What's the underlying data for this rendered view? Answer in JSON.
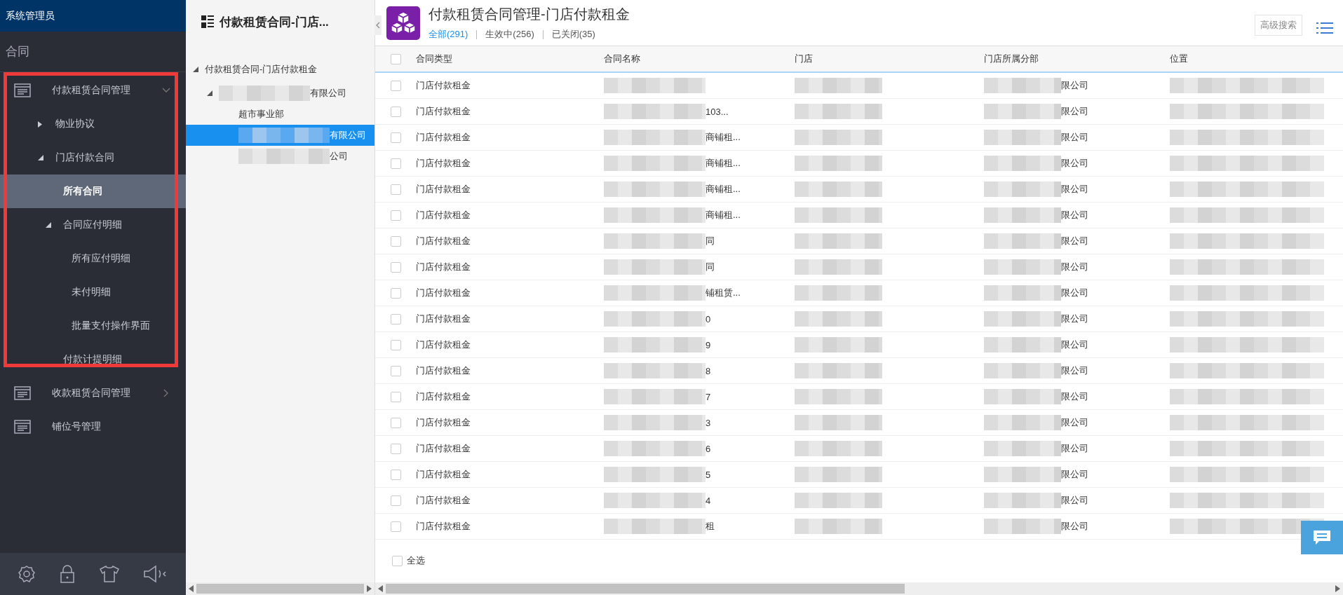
{
  "sidebar": {
    "user": "系统管理员",
    "section": "合同",
    "menu": [
      {
        "label": "付款租赁合同管理",
        "expanded": true,
        "selected": false,
        "children": [
          {
            "label": "物业协议",
            "expanded": false,
            "selected": false
          },
          {
            "label": "门店付款合同",
            "expanded": true,
            "selected": false,
            "children": [
              {
                "label": "所有合同",
                "selected": true
              },
              {
                "label": "合同应付明细",
                "expanded": true,
                "selected": false,
                "children": [
                  {
                    "label": "所有应付明细",
                    "selected": false
                  },
                  {
                    "label": "未付明细",
                    "selected": false
                  },
                  {
                    "label": "批量支付操作界面",
                    "selected": false
                  }
                ]
              },
              {
                "label": "付款计提明细",
                "selected": false
              }
            ]
          }
        ]
      },
      {
        "label": "收款租赁合同管理",
        "expanded": false,
        "selected": false
      },
      {
        "label": "铺位号管理",
        "selected": false
      }
    ]
  },
  "tree_panel": {
    "title": "付款租赁合同-门店...",
    "nodes": [
      {
        "label": "付款租赁合同-门店付款租金",
        "expanded": true,
        "selected": false,
        "children": [
          {
            "label": "有限公司",
            "redacted": true,
            "expanded": true,
            "selected": false,
            "children": [
              {
                "label": "超市事业部",
                "selected": false
              },
              {
                "label": "有限公司",
                "redacted": true,
                "selected": true
              },
              {
                "label": "公司",
                "redacted": true,
                "selected": false
              }
            ]
          }
        ]
      }
    ]
  },
  "header": {
    "title": "付款租赁合同管理-门店付款租金",
    "tabs": [
      {
        "label": "全部(291)",
        "selected": true
      },
      {
        "label": "生效中(256)",
        "selected": false
      },
      {
        "label": "已关闭(35)",
        "selected": false
      }
    ],
    "advanced_search": "高级搜索"
  },
  "table": {
    "header_checked": false,
    "columns": [
      "合同类型",
      "合同名称",
      "门店",
      "门店所属分部",
      "位置"
    ],
    "rows": [
      {
        "checked": false,
        "type": "门店付款租金",
        "name": "",
        "branch": "限公司"
      },
      {
        "checked": false,
        "type": "门店付款租金",
        "name": "103...",
        "branch": "限公司"
      },
      {
        "checked": false,
        "type": "门店付款租金",
        "name": "商铺租...",
        "branch": "限公司"
      },
      {
        "checked": false,
        "type": "门店付款租金",
        "name": "商铺租...",
        "branch": "限公司"
      },
      {
        "checked": false,
        "type": "门店付款租金",
        "name": "商铺租...",
        "branch": "限公司"
      },
      {
        "checked": false,
        "type": "门店付款租金",
        "name": "商铺租...",
        "branch": "限公司"
      },
      {
        "checked": false,
        "type": "门店付款租金",
        "name": "同",
        "branch": "限公司"
      },
      {
        "checked": false,
        "type": "门店付款租金",
        "name": "同",
        "branch": "限公司"
      },
      {
        "checked": false,
        "type": "门店付款租金",
        "name": "铺租赁...",
        "branch": "限公司"
      },
      {
        "checked": false,
        "type": "门店付款租金",
        "name": "0",
        "branch": "限公司"
      },
      {
        "checked": false,
        "type": "门店付款租金",
        "name": "9",
        "branch": "限公司"
      },
      {
        "checked": false,
        "type": "门店付款租金",
        "name": "8",
        "branch": "限公司"
      },
      {
        "checked": false,
        "type": "门店付款租金",
        "name": "7",
        "branch": "限公司"
      },
      {
        "checked": false,
        "type": "门店付款租金",
        "name": "3",
        "branch": "限公司"
      },
      {
        "checked": false,
        "type": "门店付款租金",
        "name": "6",
        "branch": "限公司"
      },
      {
        "checked": false,
        "type": "门店付款租金",
        "name": "5",
        "branch": "限公司"
      },
      {
        "checked": false,
        "type": "门店付款租金",
        "name": "4",
        "branch": "限公司"
      },
      {
        "checked": false,
        "type": "门店付款租金",
        "name": "租",
        "branch": "限公司"
      }
    ],
    "select_all": {
      "label": "全选",
      "checked": false
    }
  }
}
